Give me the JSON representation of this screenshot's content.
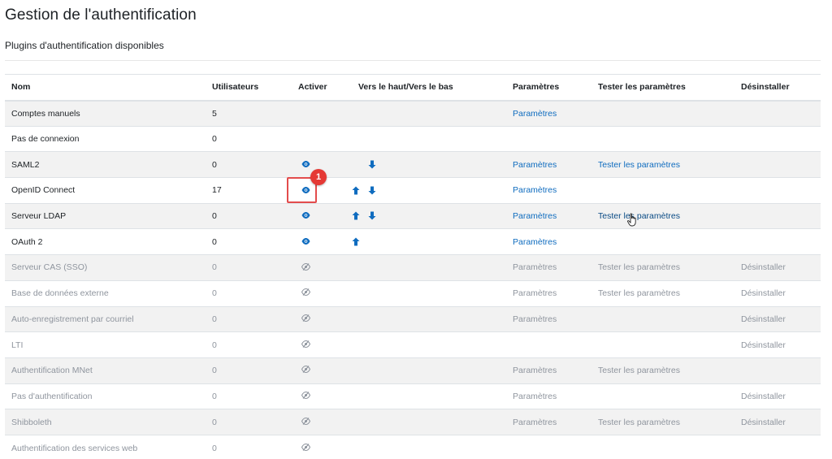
{
  "page": {
    "title": "Gestion de l'authentification",
    "subtitle": "Plugins d'authentification disponibles"
  },
  "table": {
    "headers": {
      "name": "Nom",
      "users": "Utilisateurs",
      "enable": "Activer",
      "order": "Vers le haut/Vers le bas",
      "settings": "Paramètres",
      "test": "Tester les paramètres",
      "uninstall": "Désinstaller"
    },
    "rows": [
      {
        "name": "Comptes manuels",
        "users": "5",
        "enabled": null,
        "up": false,
        "down": false,
        "settings": "Paramètres",
        "test": "",
        "uninstall": "",
        "disabled": false
      },
      {
        "name": "Pas de connexion",
        "users": "0",
        "enabled": null,
        "up": false,
        "down": false,
        "settings": "",
        "test": "",
        "uninstall": "",
        "disabled": false
      },
      {
        "name": "SAML2",
        "users": "0",
        "enabled": true,
        "up": false,
        "down": true,
        "settings": "Paramètres",
        "test": "Tester les paramètres",
        "uninstall": "",
        "disabled": false
      },
      {
        "name": "OpenID Connect",
        "users": "17",
        "enabled": true,
        "up": true,
        "down": true,
        "settings": "Paramètres",
        "test": "",
        "uninstall": "",
        "disabled": false
      },
      {
        "name": "Serveur LDAP",
        "users": "0",
        "enabled": true,
        "up": true,
        "down": true,
        "settings": "Paramètres",
        "test": "Tester les paramètres",
        "uninstall": "",
        "disabled": false,
        "hover_test": true
      },
      {
        "name": "OAuth 2",
        "users": "0",
        "enabled": true,
        "up": true,
        "down": false,
        "settings": "Paramètres",
        "test": "",
        "uninstall": "",
        "disabled": false
      },
      {
        "name": "Serveur CAS (SSO)",
        "users": "0",
        "enabled": false,
        "up": false,
        "down": false,
        "settings": "Paramètres",
        "test": "Tester les paramètres",
        "uninstall": "Désinstaller",
        "disabled": true
      },
      {
        "name": "Base de données externe",
        "users": "0",
        "enabled": false,
        "up": false,
        "down": false,
        "settings": "Paramètres",
        "test": "Tester les paramètres",
        "uninstall": "Désinstaller",
        "disabled": true
      },
      {
        "name": "Auto-enregistrement par courriel",
        "users": "0",
        "enabled": false,
        "up": false,
        "down": false,
        "settings": "Paramètres",
        "test": "",
        "uninstall": "Désinstaller",
        "disabled": true
      },
      {
        "name": "LTI",
        "users": "0",
        "enabled": false,
        "up": false,
        "down": false,
        "settings": "",
        "test": "",
        "uninstall": "Désinstaller",
        "disabled": true
      },
      {
        "name": "Authentification MNet",
        "users": "0",
        "enabled": false,
        "up": false,
        "down": false,
        "settings": "Paramètres",
        "test": "Tester les paramètres",
        "uninstall": "",
        "disabled": true
      },
      {
        "name": "Pas d'authentification",
        "users": "0",
        "enabled": false,
        "up": false,
        "down": false,
        "settings": "Paramètres",
        "test": "",
        "uninstall": "Désinstaller",
        "disabled": true
      },
      {
        "name": "Shibboleth",
        "users": "0",
        "enabled": false,
        "up": false,
        "down": false,
        "settings": "Paramètres",
        "test": "Tester les paramètres",
        "uninstall": "Désinstaller",
        "disabled": true
      },
      {
        "name": "Authentification des services web",
        "users": "0",
        "enabled": false,
        "up": false,
        "down": false,
        "settings": "",
        "test": "",
        "uninstall": "",
        "disabled": true
      }
    ]
  },
  "annotation": {
    "badge_number": "1"
  },
  "colors": {
    "link": "#0f6cbf",
    "muted": "#8f959e",
    "highlight": "#e34c4c"
  }
}
